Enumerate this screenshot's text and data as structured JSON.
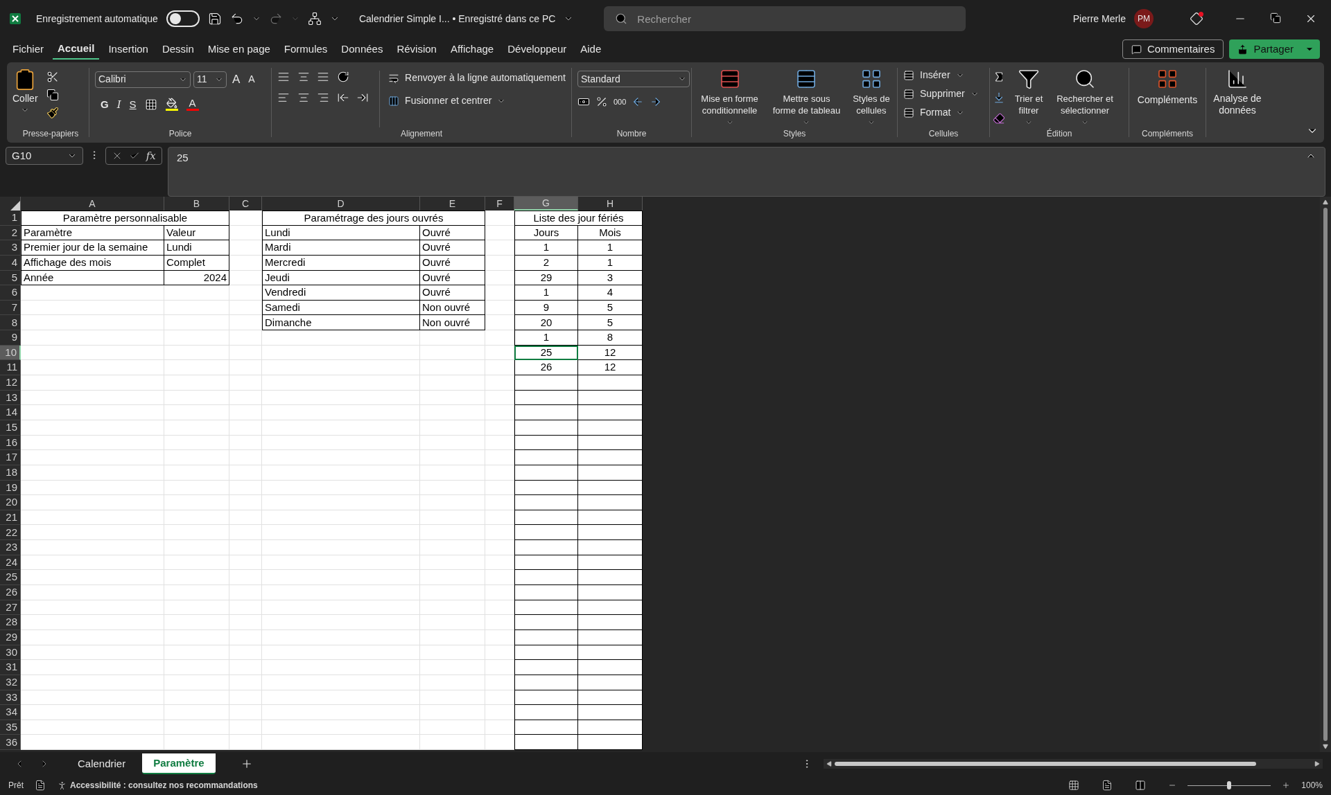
{
  "title_bar": {
    "autosave_label": "Enregistrement automatique",
    "autosave_on": false,
    "document_title": "Calendrier Simple I... • Enregistré dans ce PC",
    "search_placeholder": "Rechercher",
    "user_name": "Pierre Merle",
    "user_initials": "PM",
    "notification": true
  },
  "menu_tabs": [
    {
      "label": "Fichier",
      "selected": false
    },
    {
      "label": "Accueil",
      "selected": true
    },
    {
      "label": "Insertion",
      "selected": false
    },
    {
      "label": "Dessin",
      "selected": false
    },
    {
      "label": "Mise en page",
      "selected": false
    },
    {
      "label": "Formules",
      "selected": false
    },
    {
      "label": "Données",
      "selected": false
    },
    {
      "label": "Révision",
      "selected": false
    },
    {
      "label": "Affichage",
      "selected": false
    },
    {
      "label": "Développeur",
      "selected": false
    },
    {
      "label": "Aide",
      "selected": false
    }
  ],
  "comments_button": "Commentaires",
  "share_button": "Partager",
  "ribbon": {
    "clipboard": {
      "paste_label": "Coller",
      "group_label": "Presse-papiers"
    },
    "font": {
      "font_name": "Calibri",
      "font_size": "11",
      "bold_label": "G",
      "italic_label": "I",
      "underline_label": "S",
      "grow_label": "A",
      "shrink_label": "A",
      "color_label": "A",
      "group_label": "Police"
    },
    "alignment": {
      "wrap_label": "Renvoyer à la ligne automatiquement",
      "merge_label": "Fusionner et centrer",
      "group_label": "Alignement"
    },
    "number": {
      "format": "Standard",
      "thousands_label": "000",
      "group_label": "Nombre"
    },
    "styles": {
      "buttons": [
        "Mise en forme conditionnelle",
        "Mettre sous forme de tableau",
        "Styles de cellules"
      ],
      "group_label": "Styles"
    },
    "cells": {
      "buttons": [
        "Insérer",
        "Supprimer",
        "Format"
      ],
      "group_label": "Cellules"
    },
    "editing": {
      "sort_label": "Trier et filtrer",
      "find_label": "Rechercher et sélectionner",
      "group_label": "Édition"
    },
    "addins": {
      "addins_label": "Compléments",
      "analysis_label": "Analyse de données",
      "group_label": "Compléments"
    }
  },
  "formula_bar": {
    "name_box": "G10",
    "function_label": "fx",
    "formula": "25"
  },
  "column_headers": [
    {
      "label": "A",
      "selected": false
    },
    {
      "label": "B",
      "selected": false
    },
    {
      "label": "C",
      "selected": false
    },
    {
      "label": "D",
      "selected": false
    },
    {
      "label": "E",
      "selected": false
    },
    {
      "label": "F",
      "selected": false
    },
    {
      "label": "G",
      "selected": true
    },
    {
      "label": "H",
      "selected": false
    }
  ],
  "row_headers": [
    {
      "label": "1",
      "selected": false
    },
    {
      "label": "2",
      "selected": false
    },
    {
      "label": "3",
      "selected": false
    },
    {
      "label": "4",
      "selected": false
    },
    {
      "label": "5",
      "selected": false
    },
    {
      "label": "6",
      "selected": false
    },
    {
      "label": "7",
      "selected": false
    },
    {
      "label": "8",
      "selected": false
    },
    {
      "label": "9",
      "selected": false
    },
    {
      "label": "10",
      "selected": true
    },
    {
      "label": "11",
      "selected": false
    },
    {
      "label": "12",
      "selected": false
    },
    {
      "label": "13",
      "selected": false
    },
    {
      "label": "14",
      "selected": false
    },
    {
      "label": "15",
      "selected": false
    },
    {
      "label": "16",
      "selected": false
    },
    {
      "label": "17",
      "selected": false
    },
    {
      "label": "18",
      "selected": false
    },
    {
      "label": "19",
      "selected": false
    },
    {
      "label": "20",
      "selected": false
    },
    {
      "label": "21",
      "selected": false
    },
    {
      "label": "22",
      "selected": false
    },
    {
      "label": "23",
      "selected": false
    },
    {
      "label": "24",
      "selected": false
    },
    {
      "label": "25",
      "selected": false
    },
    {
      "label": "26",
      "selected": false
    },
    {
      "label": "27",
      "selected": false
    },
    {
      "label": "28",
      "selected": false
    },
    {
      "label": "29",
      "selected": false
    },
    {
      "label": "30",
      "selected": false
    },
    {
      "label": "31",
      "selected": false
    },
    {
      "label": "32",
      "selected": false
    },
    {
      "label": "33",
      "selected": false
    },
    {
      "label": "34",
      "selected": false
    },
    {
      "label": "35",
      "selected": false
    },
    {
      "label": "36",
      "selected": false
    }
  ],
  "settings_table": {
    "title": "Paramètre personnalisable",
    "rows": [
      {
        "label": "Paramètre",
        "value": "Valeur",
        "numeric": false
      },
      {
        "label": "Premier jour de la semaine",
        "value": "Lundi",
        "numeric": false
      },
      {
        "label": "Affichage des mois",
        "value": "Complet",
        "numeric": false
      },
      {
        "label": "Année",
        "value": "2024",
        "numeric": true
      }
    ]
  },
  "workdays_table": {
    "title": "Paramétrage des jours ouvrés",
    "rows": [
      {
        "day": "Lundi",
        "status": "Ouvré"
      },
      {
        "day": "Mardi",
        "status": "Ouvré"
      },
      {
        "day": "Mercredi",
        "status": "Ouvré"
      },
      {
        "day": "Jeudi",
        "status": "Ouvré"
      },
      {
        "day": "Vendredi",
        "status": "Ouvré"
      },
      {
        "day": "Samedi",
        "status": "Non ouvré"
      },
      {
        "day": "Dimanche",
        "status": "Non ouvré"
      }
    ]
  },
  "holidays_table": {
    "title": "Liste des jour fériés",
    "headers": [
      "Jours",
      "Mois"
    ],
    "rows": [
      {
        "day": "1",
        "month": "1",
        "selected": false
      },
      {
        "day": "2",
        "month": "1",
        "selected": false
      },
      {
        "day": "29",
        "month": "3",
        "selected": false
      },
      {
        "day": "1",
        "month": "4",
        "selected": false
      },
      {
        "day": "9",
        "month": "5",
        "selected": false
      },
      {
        "day": "20",
        "month": "5",
        "selected": false
      },
      {
        "day": "1",
        "month": "8",
        "selected": false
      },
      {
        "day": "25",
        "month": "12",
        "selected": true
      },
      {
        "day": "26",
        "month": "12",
        "selected": false
      }
    ]
  },
  "sheet_tabs": [
    {
      "label": "Calendrier",
      "selected": false
    },
    {
      "label": "Paramètre",
      "selected": true
    }
  ],
  "status_bar": {
    "status": "Prêt",
    "accessibility": "Accessibilité : consultez nos recommandations",
    "zoom": "100%",
    "zoom_slider": {
      "level": 0.5
    }
  }
}
